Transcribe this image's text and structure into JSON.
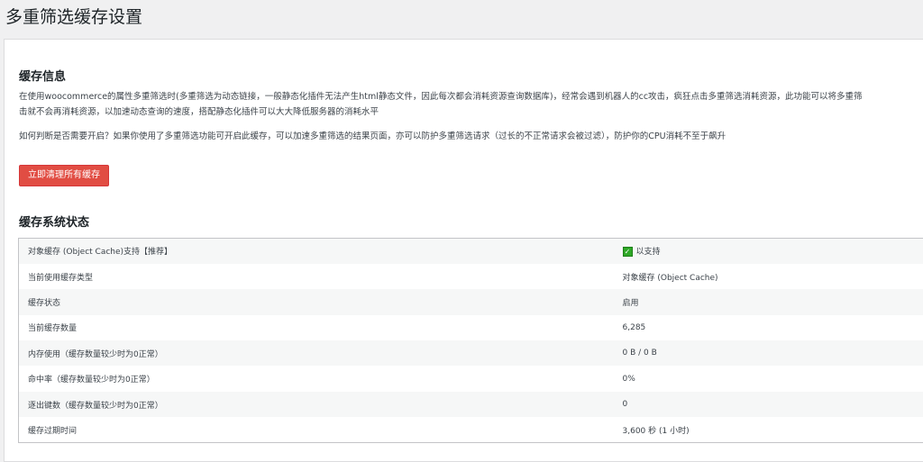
{
  "page_title": "多重筛选缓存设置",
  "info": {
    "heading": "缓存信息",
    "para1_line1": "在使用woocommerce的属性多重筛选时(多重筛选为动态链接，一般静态化插件无法产生html静态文件，因此每次都会消耗资源查询数据库)，经常会遇到机器人的cc攻击，疯狂点击多重筛选消耗资源，此功能可以将多重筛",
    "para1_line2": "击就不会再消耗资源，以加速动态查询的速度，搭配静态化插件可以大大降低服务器的消耗水平",
    "para2": "如何判断是否需要开启？如果你使用了多重筛选功能可开启此缓存，可以加速多重筛选的结果页面，亦可以防护多重筛选请求（过长的不正常请求会被过滤），防护你的CPU消耗不至于飙升",
    "clear_button": "立即清理所有缓存"
  },
  "status": {
    "heading": "缓存系统状态",
    "rows": [
      {
        "label": "对象缓存 (Object Cache)支持【推荐】",
        "value": "以支持",
        "icon": "check-icon"
      },
      {
        "label": "当前使用缓存类型",
        "value": "对象缓存 (Object Cache)"
      },
      {
        "label": "缓存状态",
        "value": "启用"
      },
      {
        "label": "当前缓存数量",
        "value": "6,285"
      },
      {
        "label": "内存使用（缓存数量较少时为0正常）",
        "value": "0 B / 0 B"
      },
      {
        "label": "命中率（缓存数量较少时为0正常）",
        "value": "0%"
      },
      {
        "label": "逐出键数（缓存数量较少时为0正常）",
        "value": "0"
      },
      {
        "label": "缓存过期时间",
        "value": "3,600 秒 (1 小时)"
      }
    ]
  },
  "colors": {
    "danger_button": "#e14d43",
    "check": "#2fa827"
  }
}
